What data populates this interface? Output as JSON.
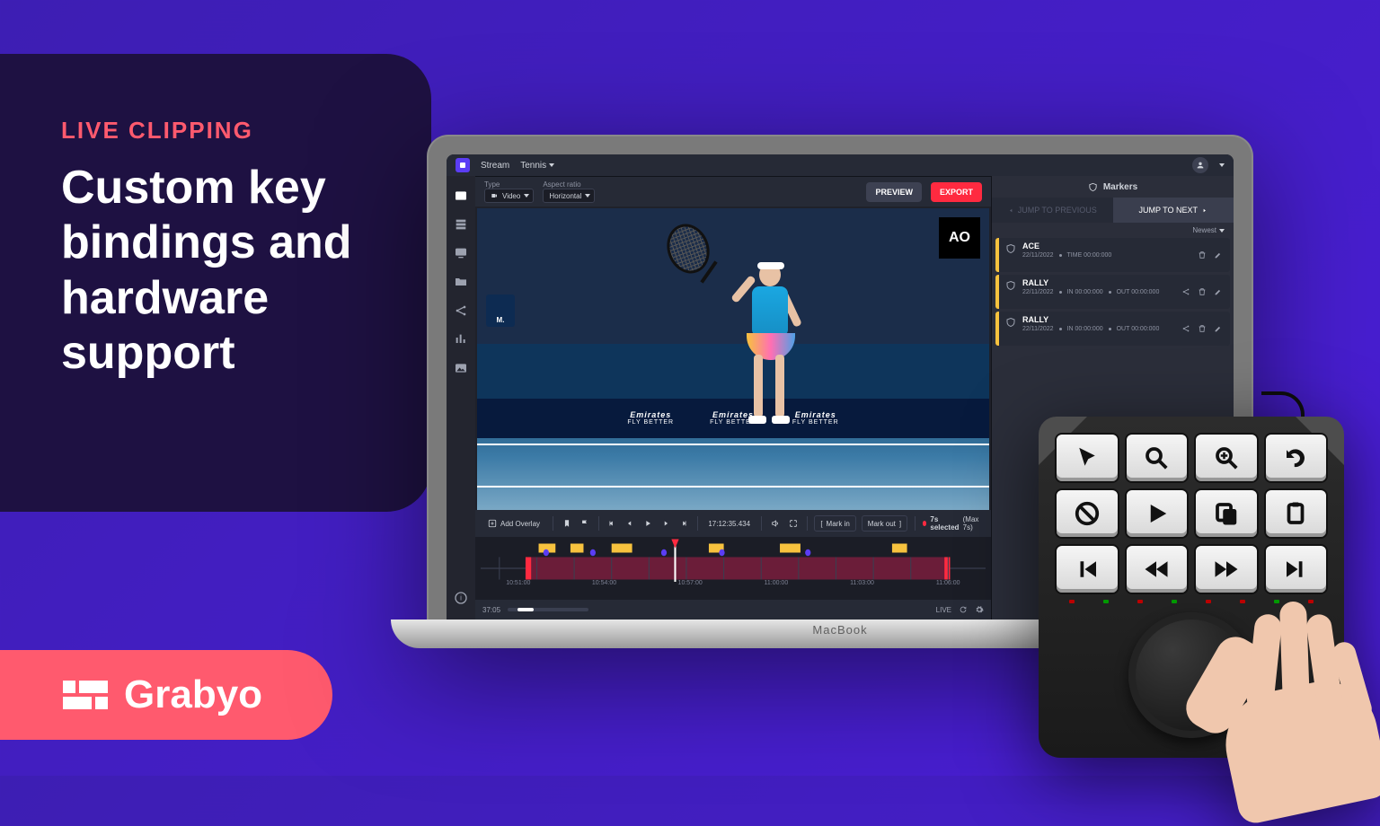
{
  "promo": {
    "category": "LIVE CLIPPING",
    "headline": "Custom key bindings and hardware support"
  },
  "brand": {
    "name": "Grabyo"
  },
  "laptop": {
    "model": "MacBook"
  },
  "app": {
    "topbar": {
      "stream_label": "Stream",
      "stream_context": "Tennis"
    },
    "controls": {
      "type_label": "Type",
      "type_value": "Video",
      "aspect_label": "Aspect ratio",
      "aspect_value": "Horizontal",
      "preview_btn": "PREVIEW",
      "export_btn": "EXPORT"
    },
    "video": {
      "overlay_badge": "AO",
      "match_chip": "M.",
      "sponsor_main": "Emirates",
      "sponsor_sub": "FLY BETTER"
    },
    "transport": {
      "add_overlay": "Add Overlay",
      "timecode": "17:12:35.434",
      "mark_in": "Mark in",
      "mark_out": "Mark out",
      "selected": "7s selected",
      "max": "(Max 7s)"
    },
    "timeline": {
      "ticks": [
        "10:51:00",
        "10:54:00",
        "10:57:00",
        "11:00:00",
        "11:03:00",
        "11:06:00"
      ]
    },
    "status": {
      "position": "37:05",
      "live": "LIVE"
    },
    "markers": {
      "title": "Markers",
      "jump_prev": "JUMP TO PREVIOUS",
      "jump_next": "JUMP TO NEXT",
      "sort": "Newest",
      "items": [
        {
          "title": "ACE",
          "date": "22/11/2022",
          "in_label": "TIME",
          "in": "00:00:000",
          "out_label": "",
          "out": ""
        },
        {
          "title": "RALLY",
          "date": "22/11/2022",
          "in_label": "IN",
          "in": "00:00:000",
          "out_label": "OUT",
          "out": "00:00:000"
        },
        {
          "title": "RALLY",
          "date": "22/11/2022",
          "in_label": "IN",
          "in": "00:00:000",
          "out_label": "OUT",
          "out": "00:00:000"
        }
      ]
    }
  },
  "keypad": {
    "keys": [
      "cursor",
      "zoom",
      "zoom-in",
      "undo",
      "cancel",
      "play",
      "copy",
      "paste",
      "skip-back",
      "rewind",
      "forward",
      "skip-forward"
    ]
  }
}
